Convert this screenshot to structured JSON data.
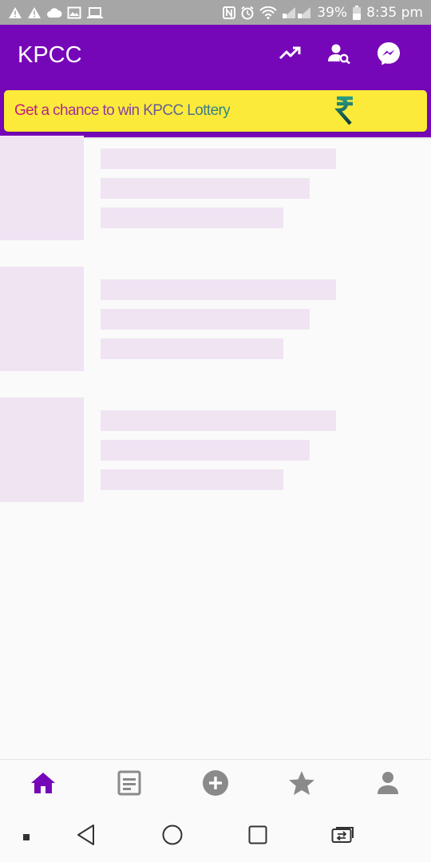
{
  "status_bar": {
    "battery_percent": "39%",
    "time": "8:35 pm"
  },
  "app_bar": {
    "title": "KPCC",
    "actions": [
      "trending-up-icon",
      "user-search-icon",
      "messenger-icon"
    ]
  },
  "banner": {
    "text": "Get a chance to win KPCC Lottery",
    "icon": "rupee-icon"
  },
  "colors": {
    "primary": "#7607b9",
    "banner_background": "#fcea3a",
    "skeleton": "#f0e4f3",
    "nav_active": "#7607b9",
    "nav_inactive": "#8a8a8a"
  },
  "feed": {
    "loading_placeholders": 3
  },
  "bottom_nav": {
    "items": [
      {
        "icon": "home-icon",
        "active": true
      },
      {
        "icon": "feed-icon",
        "active": false
      },
      {
        "icon": "add-circle-icon",
        "active": false
      },
      {
        "icon": "star-icon",
        "active": false
      },
      {
        "icon": "profile-icon",
        "active": false
      }
    ]
  },
  "system_nav": {
    "buttons": [
      "dot-icon",
      "back-icon",
      "home-circle-icon",
      "recents-icon",
      "switch-app-icon"
    ]
  }
}
